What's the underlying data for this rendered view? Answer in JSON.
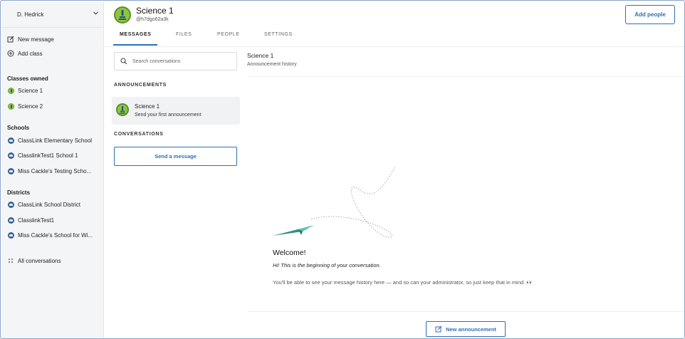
{
  "sidebar": {
    "user_name": "D. Hedrick",
    "actions": {
      "new_message": "New message",
      "add_class": "Add class"
    },
    "classes_heading": "Classes owned",
    "classes": [
      "Science 1",
      "Science 2"
    ],
    "schools_heading": "Schools",
    "schools": [
      "ClassLink Elementary School",
      "ClasslinkTest1 School 1",
      "Miss Cackle's Testing Scho..."
    ],
    "districts_heading": "Districts",
    "districts": [
      "ClassLink School District",
      "ClasslinkTest1",
      "Miss Cackle's School for Wi..."
    ],
    "all_conversations": "All conversations"
  },
  "header": {
    "class_name": "Science 1",
    "class_code": "@h7dgo62a3k",
    "add_people_label": "Add people",
    "tabs": [
      "MESSAGES",
      "FILES",
      "PEOPLE",
      "SETTINGS"
    ],
    "active_tab": "MESSAGES"
  },
  "list": {
    "search_placeholder": "Search conversations",
    "announcements_heading": "ANNOUNCEMENTS",
    "announcement": {
      "title": "Science 1",
      "subtitle": "Send your first announcement"
    },
    "conversations_heading": "CONVERSATIONS",
    "send_message_label": "Send a message"
  },
  "conversation": {
    "title": "Science 1",
    "subtitle": "Announcement history",
    "welcome": "Welcome!",
    "intro": "Hi! This is the beginning of your conversation.",
    "body": "You'll be able to see your message history here — and so can your administrator, so just keep that in mind. 👀",
    "new_announcement_label": "New announcement"
  },
  "colors": {
    "accent": "#2f6fb6",
    "sidebar_bg": "#f4f5f7",
    "class_avatar": "#8cc63f",
    "plane": "#3fae9c"
  }
}
